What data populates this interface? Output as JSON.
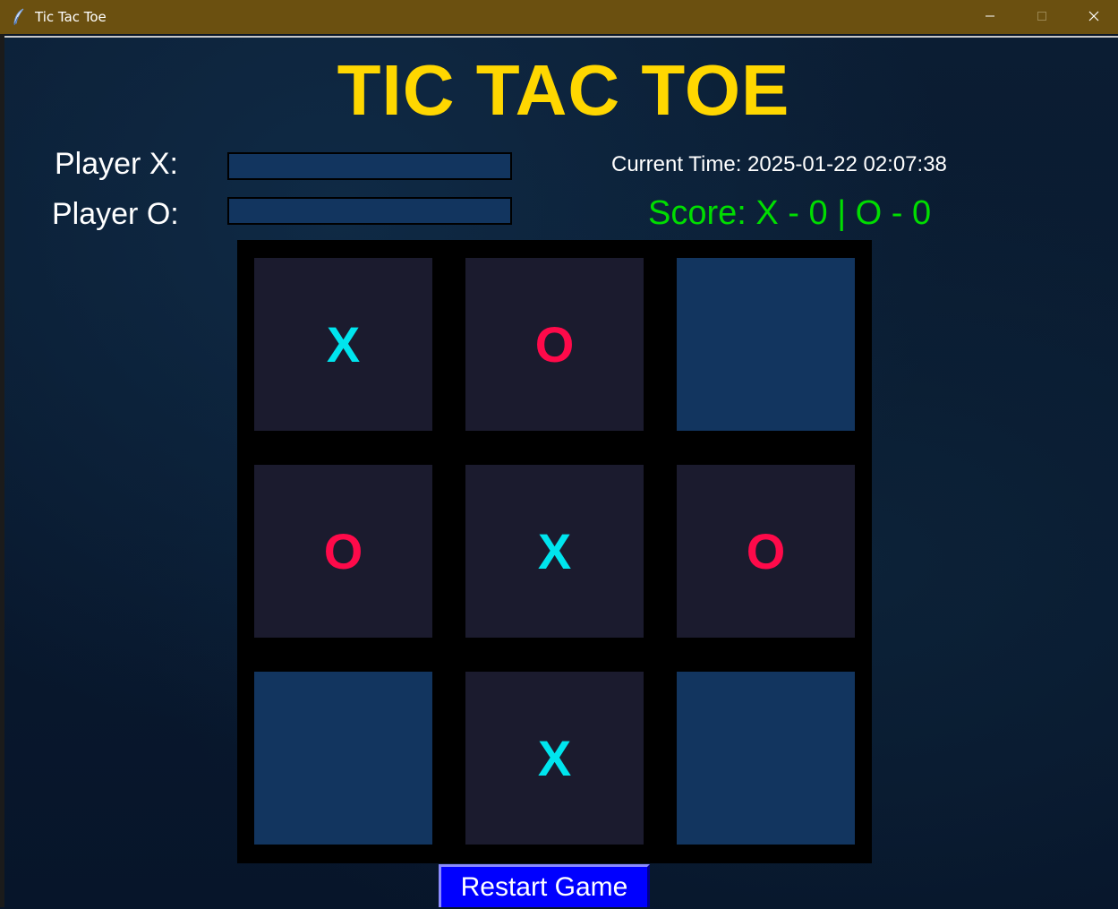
{
  "window": {
    "title": "Tic Tac Toe",
    "icon": "feather-icon",
    "controls": [
      "minimize-icon",
      "maximize-icon",
      "close-icon"
    ]
  },
  "game": {
    "title": "TIC TAC TOE",
    "player_x_label": "Player X:",
    "player_o_label": "Player O:",
    "player_x_name": "",
    "player_o_name": "",
    "current_time": "Current Time: 2025-01-22 02:07:38",
    "score": "Score: X - 0 | O - 0",
    "board": [
      "X",
      "O",
      "",
      "O",
      "X",
      "O",
      "",
      "X",
      ""
    ],
    "restart_label": "Restart Game"
  },
  "colors": {
    "title": "#ffd700",
    "x_mark": "#00e5ee",
    "o_mark": "#ff0a4a",
    "score": "#00dd00",
    "empty_cell": "#12355f",
    "filled_cell": "#1b1b2e",
    "restart_button": "#0000ff",
    "titlebar": "#6b5010"
  }
}
